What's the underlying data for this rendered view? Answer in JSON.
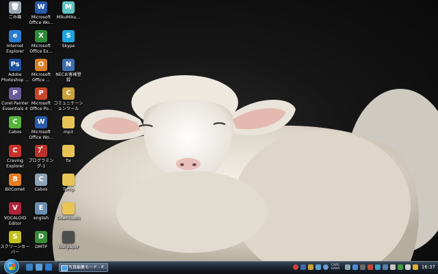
{
  "desktop": {
    "icons": [
      {
        "name": "recycle-bin-icon",
        "label": "ごみ箱",
        "color": "#9aa7b3",
        "ch": "🗑"
      },
      {
        "name": "internet-explorer-icon",
        "label": "Internet\nExplorer",
        "color": "#2b7bd1",
        "ch": "e"
      },
      {
        "name": "adobe-photoshop-icon",
        "label": "Adobe\nPhotoshop ...",
        "color": "#1c4f9c",
        "ch": "Ps"
      },
      {
        "name": "corel-painter-icon",
        "label": "Corel Painter\nEssentials 4",
        "color": "#6a5a9a",
        "ch": "P"
      },
      {
        "name": "cabos-icon",
        "label": "Cabos",
        "color": "#57b33a",
        "ch": "C"
      },
      {
        "name": "craving-explorer-icon",
        "label": "Craving\nExplorer",
        "color": "#c8322b",
        "ch": "C"
      },
      {
        "name": "bitcomet-icon",
        "label": "BitComet",
        "color": "#e67e22",
        "ch": "B"
      },
      {
        "name": "vocaloid-editor-icon",
        "label": "VOCALOID\nEditor",
        "color": "#b0243a",
        "ch": "V"
      },
      {
        "name": "screensaver-icon",
        "label": "スクリーンセー\nバー",
        "color": "#c6c020",
        "ch": "S"
      },
      {
        "name": "word-icon",
        "label": "Microsoft\nOffice Wo...",
        "color": "#2a5aa8",
        "ch": "W"
      },
      {
        "name": "excel-icon",
        "label": "Microsoft\nOffice Ex...",
        "color": "#2e8b3a",
        "ch": "X"
      },
      {
        "name": "office-icon",
        "label": "Microsoft\nOffice ...",
        "color": "#d9802a",
        "ch": "O"
      },
      {
        "name": "powerpoint-icon",
        "label": "Microsoft\nOffice Po...",
        "color": "#c8472b",
        "ch": "P"
      },
      {
        "name": "word2-icon",
        "label": "Microsoft\nOffice Wo...",
        "color": "#2a5aa8",
        "ch": "W"
      },
      {
        "name": "program-icon",
        "label": "プログラミン\nグ-1",
        "color": "#b8322b",
        "ch": "ﾌﾟ"
      },
      {
        "name": "cabos-shortcut-icon",
        "label": "Cabos",
        "color": "#8fa3b7",
        "ch": "C"
      },
      {
        "name": "english-icon",
        "label": "english",
        "color": "#6b8eb0",
        "ch": "E"
      },
      {
        "name": "dmjp-icon",
        "label": "DMTP",
        "color": "#3a8a3a",
        "ch": "D"
      },
      {
        "name": "mikumiku-icon",
        "label": "MikuMiku...",
        "color": "#5fc6c4",
        "ch": "M"
      },
      {
        "name": "skype-icon",
        "label": "Skype",
        "color": "#1fa5e0",
        "ch": "S"
      },
      {
        "name": "nec-icon",
        "label": "NECお客様登\n録",
        "color": "#3d6fb0",
        "ch": "N"
      },
      {
        "name": "communication-icon",
        "label": "コミュニケーションツール",
        "color": "#c9a13a",
        "ch": "C"
      },
      {
        "name": "mp3-folder-icon",
        "label": "mp3",
        "color": "#e8c454",
        "ch": ""
      },
      {
        "name": "fix-folder-icon",
        "label": "fix",
        "color": "#e8c454",
        "ch": ""
      },
      {
        "name": "temp-folder-icon",
        "label": "Temp",
        "color": "#e8c454",
        "ch": ""
      },
      {
        "name": "downloads-folder-icon",
        "label": "Downloads",
        "color": "#e8c454",
        "ch": ""
      },
      {
        "name": "wallpaper-file-icon",
        "label": "Wallpaper",
        "color": "#4d4d4d",
        "ch": ""
      }
    ]
  },
  "taskbar": {
    "active_window": "写真編集モード - P...",
    "ime_top": "CAPS",
    "ime_bottom": "KANA",
    "clock": "16:37",
    "colors": {
      "accent": "#2f7fc4"
    }
  }
}
